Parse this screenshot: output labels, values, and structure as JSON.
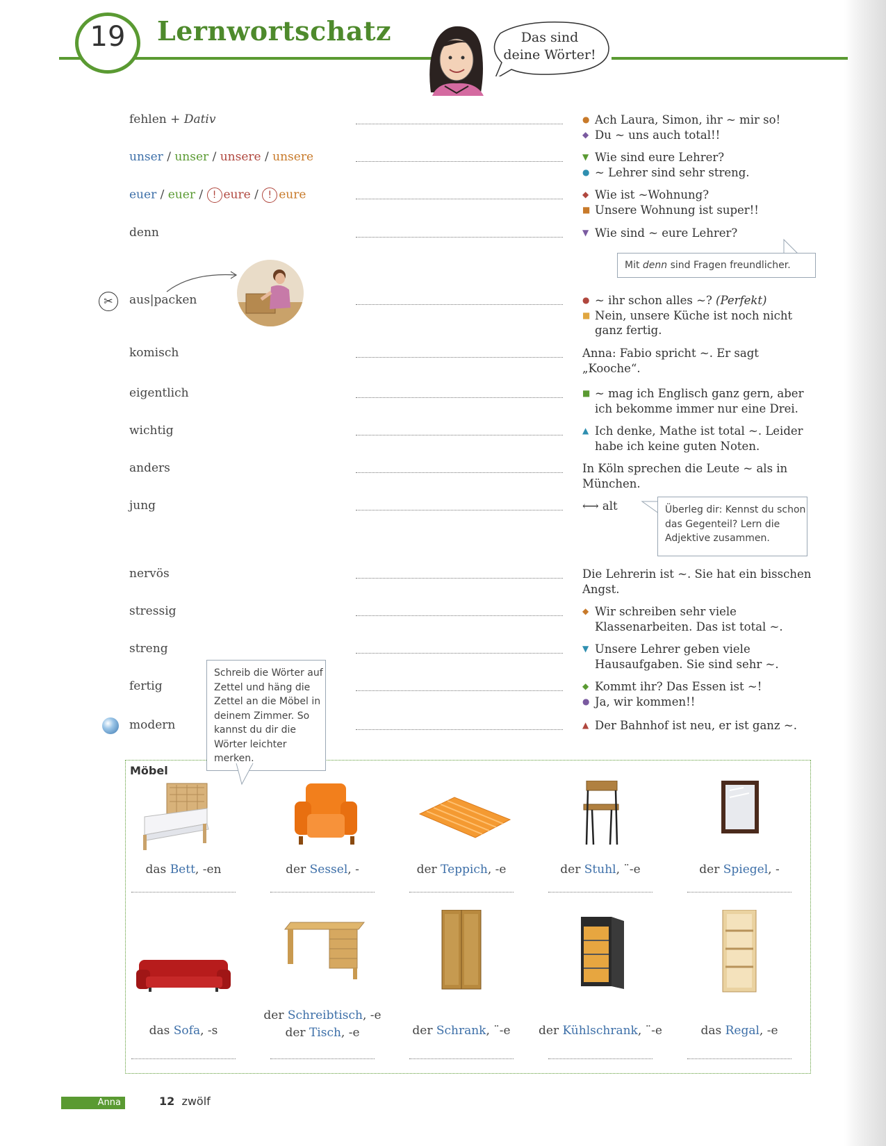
{
  "header": {
    "unit_number": "19",
    "title": "Lernwortschatz",
    "speech_bubble": [
      "Das sind",
      "deine Wörter!"
    ]
  },
  "vocab": [
    {
      "term": "fehlen + ",
      "term_italic": "Dativ",
      "lines": [
        {
          "marker": "●",
          "color": "#c87a2a",
          "text": "Ach Laura, Simon, ihr ~ mir so!"
        },
        {
          "marker": "◆",
          "color": "#7a5aa0",
          "text": "Du ~ uns auch total!!"
        }
      ]
    },
    {
      "term_parts": [
        {
          "text": "unser",
          "color": "#3d6fa8"
        },
        {
          "text": " / ",
          "color": "#444"
        },
        {
          "text": "unser",
          "color": "#5a9a32"
        },
        {
          "text": " / ",
          "color": "#444"
        },
        {
          "text": "unsere",
          "color": "#b0473e"
        },
        {
          "text": " / ",
          "color": "#444"
        },
        {
          "text": "unsere",
          "color": "#c87a2a"
        }
      ],
      "lines": [
        {
          "marker": "▼",
          "color": "#5a9a32",
          "text": "Wie sind eure Lehrer?"
        },
        {
          "marker": "●",
          "color": "#2f8fb0",
          "text": "~ Lehrer sind sehr streng."
        }
      ]
    },
    {
      "term_parts": [
        {
          "text": "euer",
          "color": "#3d6fa8"
        },
        {
          "text": " / ",
          "color": "#444"
        },
        {
          "text": "euer",
          "color": "#5a9a32"
        },
        {
          "text": " / ",
          "color": "#444"
        },
        {
          "warn": "!",
          "text": "eure",
          "color": "#b0473e"
        },
        {
          "text": " / ",
          "color": "#444"
        },
        {
          "warn": "!",
          "text": "eure",
          "color": "#c87a2a"
        }
      ],
      "lines": [
        {
          "marker": "◆",
          "color": "#b0473e",
          "text": "Wie ist ~Wohnung?"
        },
        {
          "marker": "■",
          "color": "#c87a2a",
          "text": "Unsere Wohnung ist super!!"
        }
      ]
    },
    {
      "term": "denn",
      "lines": [
        {
          "marker": "▼",
          "color": "#7a5aa0",
          "text": "Wie sind ~ eure Lehrer?"
        }
      ]
    },
    {
      "term": "aus|packen",
      "lines": [
        {
          "marker": "●",
          "color": "#b0473e",
          "text": "~ ihr schon alles ~? ",
          "italic": "(Perfekt)"
        },
        {
          "marker": "■",
          "color": "#e0a640",
          "text": "Nein, unsere Küche ist noch nicht ganz fertig."
        }
      ]
    },
    {
      "term": "komisch",
      "lines": [
        {
          "marker": "",
          "color": "",
          "text": "Anna: Fabio spricht ~. Er sagt „Kooche“."
        }
      ]
    },
    {
      "term": "eigentlich",
      "lines": [
        {
          "marker": "■",
          "color": "#5a9a32",
          "text": "~ mag ich Englisch ganz gern, aber ich bekomme immer nur eine Drei."
        }
      ]
    },
    {
      "term": "wichtig",
      "lines": [
        {
          "marker": "▲",
          "color": "#2f8fb0",
          "text": "Ich denke, Mathe ist total ~. Leider habe ich keine guten Noten."
        }
      ]
    },
    {
      "term": "anders",
      "lines": [
        {
          "marker": "",
          "color": "",
          "text": "In Köln sprechen die Leute ~ als in München."
        }
      ]
    },
    {
      "term": "jung",
      "lines": [
        {
          "marker": "",
          "color": "",
          "text": "⟷  alt"
        }
      ]
    },
    {
      "term": "nervös",
      "lines": [
        {
          "marker": "",
          "color": "",
          "text": "Die Lehrerin ist ~. Sie hat ein bisschen Angst."
        }
      ]
    },
    {
      "term": "stressig",
      "lines": [
        {
          "marker": "◆",
          "color": "#c87a2a",
          "text": "Wir schreiben sehr viele Klassenarbeiten. Das ist total ~."
        }
      ]
    },
    {
      "term": "streng",
      "lines": [
        {
          "marker": "▼",
          "color": "#2f8fb0",
          "text": "Unsere Lehrer geben viele Hausaufgaben. Sie sind sehr ~."
        }
      ]
    },
    {
      "term": "fertig",
      "lines": [
        {
          "marker": "◆",
          "color": "#5a9a32",
          "text": "Kommt ihr? Das Essen ist ~!"
        },
        {
          "marker": "●",
          "color": "#7a5aa0",
          "text": "Ja, wir kommen!!"
        }
      ]
    },
    {
      "term": "modern",
      "lines": [
        {
          "marker": "▲",
          "color": "#b0473e",
          "text": "Der Bahnhof ist neu, er ist ganz ~."
        }
      ]
    }
  ],
  "tips": {
    "denn": [
      "Mit ",
      "denn",
      " sind Fragen freundlicher."
    ],
    "opposite": "Überleg dir: Kennst du schon das Gegenteil? Lern die Adjektive zusammen.",
    "zettel": "Schreib die Wörter auf Zettel und häng die Zettel an die Möbel in deinem Zimmer. So kannst du dir die Wörter leichter merken."
  },
  "furniture": {
    "title": "Möbel",
    "items": [
      {
        "article": "das ",
        "noun": "Bett",
        "suffix": ", -en",
        "icon": "bed-icon"
      },
      {
        "article": "der ",
        "noun": "Sessel",
        "suffix": ", -",
        "icon": "armchair-icon"
      },
      {
        "article": "der ",
        "noun": "Teppich",
        "suffix": ", -e",
        "icon": "carpet-icon"
      },
      {
        "article": "der ",
        "noun": "Stuhl",
        "suffix": ", ¨-e",
        "icon": "chair-icon"
      },
      {
        "article": "der ",
        "noun": "Spiegel",
        "suffix": ", -",
        "icon": "mirror-icon"
      },
      {
        "article": "das ",
        "noun": "Sofa",
        "suffix": ", -s",
        "icon": "sofa-icon"
      },
      {
        "article": "der ",
        "noun": "Schreibtisch",
        "suffix": ", -e",
        "article2": "der ",
        "noun2": "Tisch",
        "suffix2": ", -e",
        "icon": "desk-icon"
      },
      {
        "article": "der ",
        "noun": "Schrank",
        "suffix": ", ¨-e",
        "icon": "wardrobe-icon"
      },
      {
        "article": "der ",
        "noun": "Kühlschrank",
        "suffix": ", ¨-e",
        "icon": "fridge-icon"
      },
      {
        "article": "das ",
        "noun": "Regal",
        "suffix": ", -e",
        "icon": "shelf-icon"
      }
    ]
  },
  "footer": {
    "name": "Anna",
    "page_number": "12",
    "page_word": "zwölf"
  },
  "colors": {
    "accent_green": "#5a9a32",
    "noun_blue": "#3d6fa8"
  }
}
